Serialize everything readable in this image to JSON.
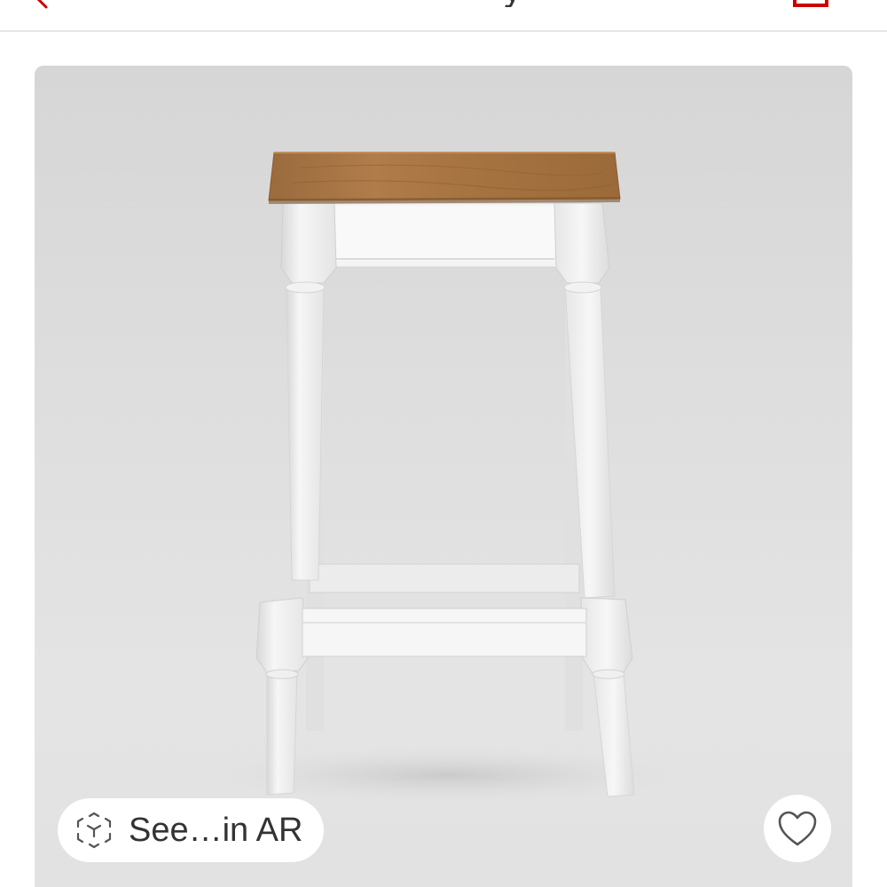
{
  "header": {
    "back_icon": "back-chevron-icon",
    "cart_icon": "cart-icon",
    "accent_color": "#cc0000"
  },
  "product": {
    "image_description_icon": "bar-stool-image",
    "ar_button": {
      "label": "See…in AR",
      "icon": "ar-cube-icon"
    },
    "favorite_button": {
      "icon": "heart-icon"
    }
  }
}
